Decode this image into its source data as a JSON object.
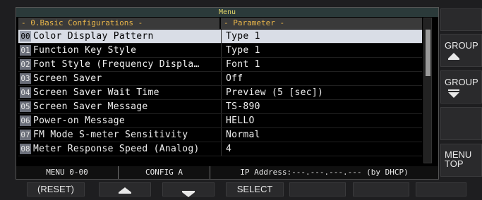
{
  "menu": {
    "title": "Menu",
    "left_header": "- 0.Basic Configurations -",
    "right_header": "- Parameter -",
    "rows": [
      {
        "num": "00",
        "name": "Color Display Pattern",
        "value": "Type 1"
      },
      {
        "num": "01",
        "name": "Function Key Style",
        "value": "Type 1"
      },
      {
        "num": "02",
        "name": "Font Style (Frequency Displa…",
        "value": "Font 1"
      },
      {
        "num": "03",
        "name": "Screen Saver",
        "value": "Off"
      },
      {
        "num": "04",
        "name": "Screen Saver Wait Time",
        "value": "Preview (5 [sec])"
      },
      {
        "num": "05",
        "name": "Screen Saver Message",
        "value": "TS-890"
      },
      {
        "num": "06",
        "name": "Power-on Message",
        "value": "HELLO"
      },
      {
        "num": "07",
        "name": "FM Mode S-meter Sensitivity",
        "value": "Normal"
      },
      {
        "num": "08",
        "name": "Meter Response Speed (Analog)",
        "value": "4"
      }
    ],
    "selected_index": 0
  },
  "status": {
    "menu_id": "MENU 0-00",
    "config": "CONFIG A",
    "ip": "IP Address:---.---.---.--- (by DHCP)"
  },
  "side_keys": {
    "group_up": "GROUP",
    "group_down": "GROUP",
    "menu_top_line1": "MENU",
    "menu_top_line2": "TOP"
  },
  "bottom_keys": {
    "reset": "(RESET)",
    "select": "SELECT"
  }
}
